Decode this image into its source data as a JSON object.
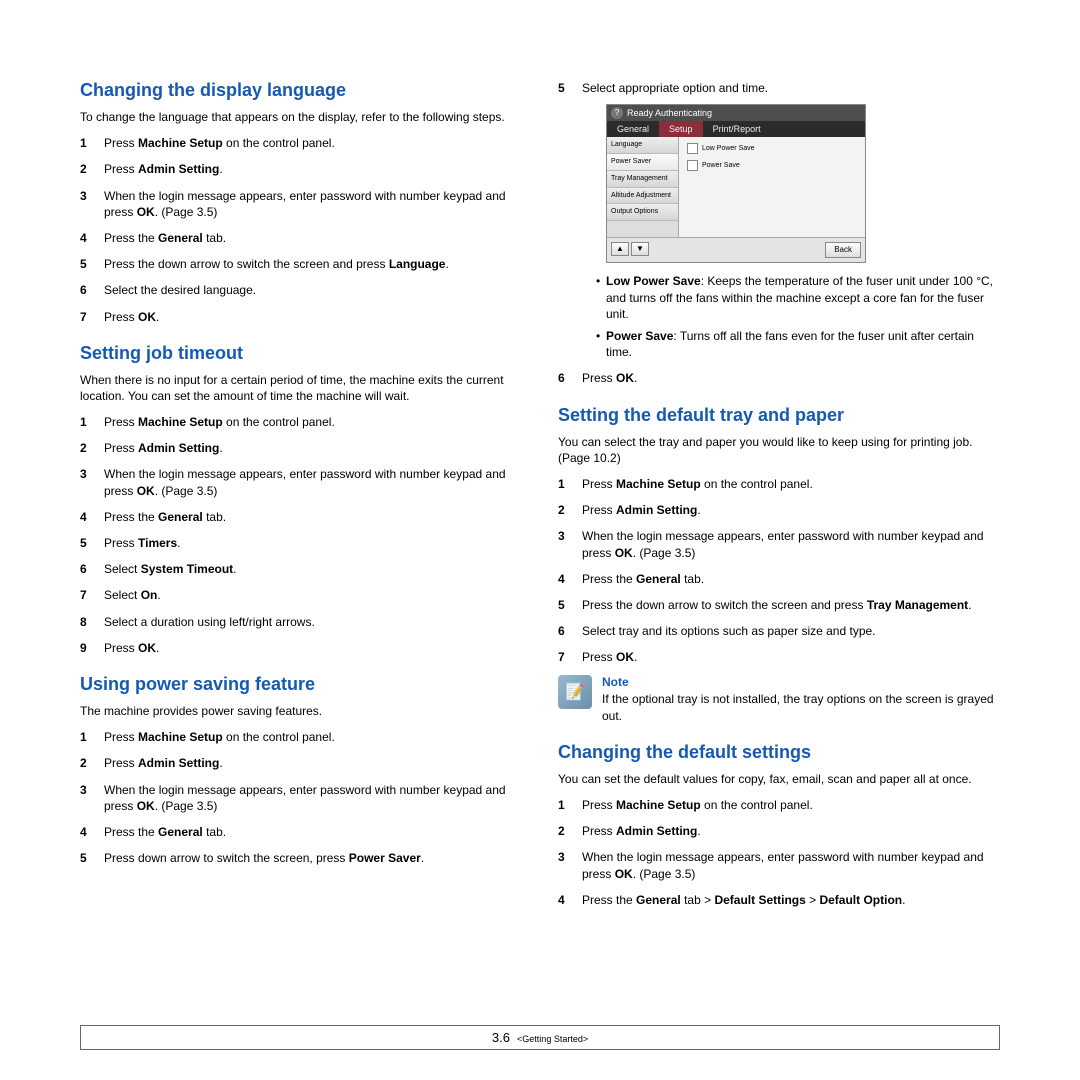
{
  "left": {
    "sec1": {
      "title": "Changing the display language",
      "intro": "To change the language that appears on the display, refer to the following steps.",
      "steps": [
        "Press <b>Machine Setup</b> on the control panel.",
        "Press <b>Admin Setting</b>.",
        "When the login message appears, enter password with number keypad and press <b>OK</b>. (Page 3.5)",
        "Press the <b>General</b> tab.",
        "Press the down arrow to switch the screen and press <b>Language</b>.",
        "Select the desired language.",
        "Press <b>OK</b>."
      ]
    },
    "sec2": {
      "title": "Setting job timeout",
      "intro": "When there is no input for a certain period of time, the machine exits the current location. You can set the amount of time the machine will wait.",
      "steps": [
        "Press <b>Machine Setup</b> on the control panel.",
        "Press <b>Admin Setting</b>.",
        "When the login message appears, enter password with number keypad and press <b>OK</b>. (Page 3.5)",
        "Press the <b>General</b> tab.",
        "Press <b>Timers</b>.",
        "Select <b>System Timeout</b>.",
        "Select <b>On</b>.",
        "Select a duration using left/right arrows.",
        "Press <b>OK</b>."
      ]
    },
    "sec3": {
      "title": "Using power saving feature",
      "intro": "The machine provides power saving features.",
      "steps": [
        "Press <b>Machine Setup</b> on the control panel.",
        "Press <b>Admin Setting</b>.",
        "When the login message appears, enter password with number keypad and press <b>OK</b>. (Page 3.5)",
        "Press the <b>General</b> tab.",
        "Press down arrow to switch the screen, press <b>Power Saver</b>."
      ]
    }
  },
  "right": {
    "step6": "Select appropriate option and time.",
    "screenshot": {
      "status": "Ready Authenticating",
      "tabs": [
        "General",
        "Setup",
        "Print/Report"
      ],
      "side": [
        "Language",
        "Power Saver",
        "Tray Management",
        "Altitude Adjustment",
        "Output Options"
      ],
      "checks": [
        "Low Power Save",
        "Power Save"
      ],
      "back": "Back"
    },
    "bullets": [
      "<b>Low Power Save</b>: Keeps the temperature of the fuser unit under 100 °C, and turns off the fans within the machine except a core fan for the fuser unit.",
      "<b>Power Save</b>: Turns off all the fans even for the fuser unit after certain time."
    ],
    "step7": "Press <b>OK</b>.",
    "sec4": {
      "title": "Setting the default tray and paper",
      "intro": "You can select the tray and paper you would like to keep using for printing job. (Page 10.2)",
      "steps": [
        "Press <b>Machine Setup</b> on the control panel.",
        "Press <b>Admin Setting</b>.",
        "When the login message appears, enter password with number keypad and press <b>OK</b>. (Page 3.5)",
        "Press the <b>General</b> tab.",
        "Press the down arrow to switch the screen and press <b>Tray Management</b>.",
        "Select tray and its options such as paper size and type.",
        "Press <b>OK</b>."
      ]
    },
    "note": {
      "title": "Note",
      "text": "If the optional tray is not installed, the tray options on the screen is grayed out."
    },
    "sec5": {
      "title": "Changing the default settings",
      "intro": "You can set the default values for copy, fax, email, scan and paper all at once.",
      "steps": [
        "Press <b>Machine Setup</b> on the control panel.",
        "Press <b>Admin Setting</b>.",
        "When the login message appears, enter password with number keypad and press <b>OK</b>. (Page 3.5)",
        "Press the <b>General</b> tab > <b>Default Settings</b> > <b>Default Option</b>."
      ]
    }
  },
  "footer": {
    "page": "3.6",
    "chapter": "<Getting Started>"
  }
}
